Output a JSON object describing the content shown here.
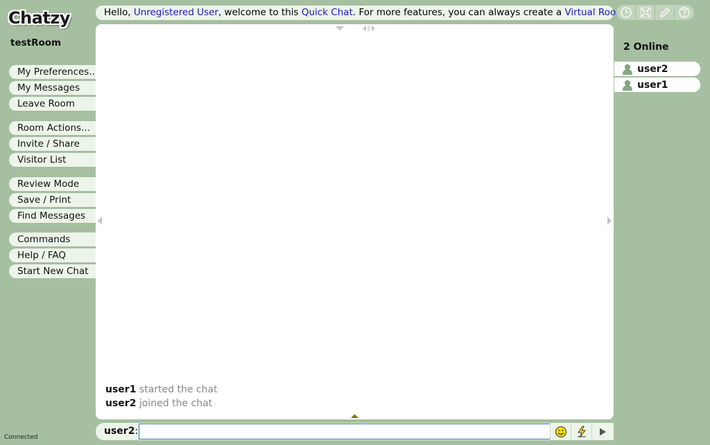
{
  "app": {
    "logo": "Chatzy",
    "room_name": "testRoom",
    "status": "Connected"
  },
  "menu": {
    "group1": [
      "My Preferences...",
      "My Messages",
      "Leave Room"
    ],
    "group2": [
      "Room Actions...",
      "Invite / Share",
      "Visitor List"
    ],
    "group3": [
      "Review Mode",
      "Save / Print",
      "Find Messages"
    ],
    "group4": [
      "Commands",
      "Help / FAQ",
      "Start New Chat"
    ]
  },
  "welcome": {
    "t1": "Hello, ",
    "user_link": "Unregistered User",
    "t2": ", welcome to this ",
    "quick_link": "Quick Chat",
    "t3": ". For more features, you can always create a ",
    "virtual_link": "Virtual Room",
    "t4": "."
  },
  "tools": [
    "clock-icon",
    "layout-icon",
    "pencil-icon",
    "help-icon"
  ],
  "messages": [
    {
      "user": "user1",
      "text": "started the chat"
    },
    {
      "user": "user2",
      "text": "joined the chat"
    }
  ],
  "online": {
    "title": "2 Online",
    "users": [
      "user2",
      "user1"
    ]
  },
  "input": {
    "label_user": "user2",
    "label_colon": ":",
    "value": "",
    "placeholder": ""
  },
  "colors": {
    "background": "#a5bfa0",
    "panel": "#edf4ea",
    "link": "#1a1ab8",
    "input_border": "#3a6fbf",
    "arrow_olive": "#7a7a00"
  }
}
